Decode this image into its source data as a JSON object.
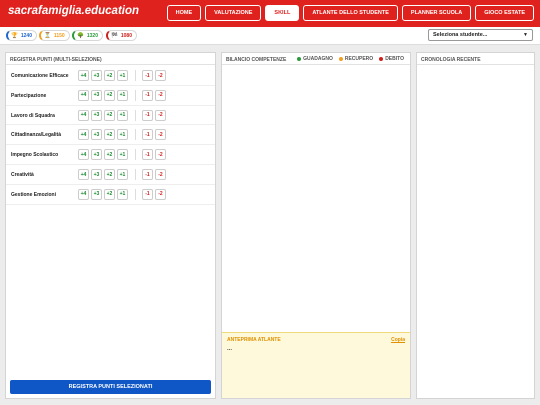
{
  "header": {
    "brand": "sacrafamiglia.education",
    "nav": [
      "HOME",
      "VALUTAZIONE",
      "SKILL",
      "ATLANTE DELLO STUDENTE",
      "PLANNER SCUOLA",
      "GIOCO ESTATE"
    ],
    "active_nav": "SKILL"
  },
  "stats": [
    {
      "value": "1240",
      "icon": "trophy-icon",
      "color": "#1e66d0"
    },
    {
      "value": "1150",
      "icon": "hourglass-icon",
      "color": "#f0a020"
    },
    {
      "value": "1320",
      "icon": "tree-icon",
      "color": "#2a9a3a"
    },
    {
      "value": "1080",
      "icon": "flag-icon",
      "color": "#d0201c"
    }
  ],
  "student_select": {
    "value": "Seleziona studente..."
  },
  "points_panel": {
    "title": "REGISTRA PUNTI (MULTI-SELEZIONE)",
    "skills": [
      "Comunicazione Efficace",
      "Partecipazione",
      "Lavoro di Squadra",
      "Cittadinanza/Legalità",
      "Impegno Scolastico",
      "Creatività",
      "Gestione Emozioni"
    ],
    "positive_buttons": [
      "+4",
      "+3",
      "+2",
      "+1"
    ],
    "negative_buttons": [
      "-1",
      "-2"
    ],
    "submit_label": "REGISTRA PUNTI SELEZIONATI"
  },
  "balance_panel": {
    "title": "BILANCIO COMPETENZE",
    "legend": [
      {
        "label": "GUADAGNO",
        "color": "#2a9a3a"
      },
      {
        "label": "RECUPERO",
        "color": "#f0a020"
      },
      {
        "label": "DEBITO",
        "color": "#d0201c"
      }
    ],
    "atlas": {
      "title": "ANTEPRIMA ATLANTE",
      "copy_label": "Copia",
      "body": "..."
    }
  },
  "history_panel": {
    "title": "CRONOLOGIA RECENTE"
  }
}
